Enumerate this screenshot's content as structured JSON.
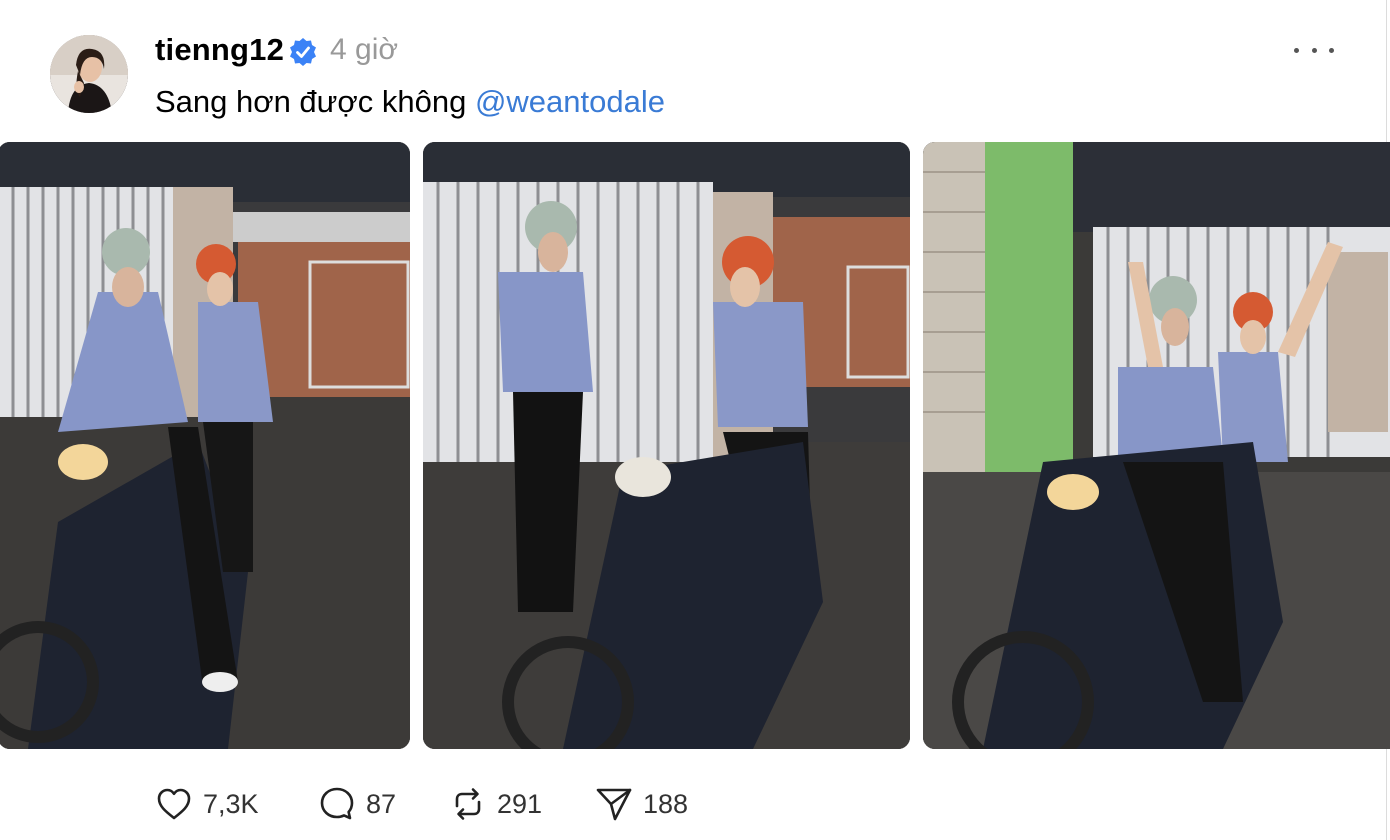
{
  "post": {
    "username": "tienng12",
    "timestamp": "4 giờ",
    "caption_text": "Sang hơn được không ",
    "mention": "@weantodale",
    "verified": true
  },
  "images": [
    {
      "name": "photo-two-riders-on-motorbike"
    },
    {
      "name": "photo-man-standing-woman-seated"
    },
    {
      "name": "photo-riders-waving"
    }
  ],
  "actions": {
    "likes": "7,3K",
    "replies": "87",
    "reposts": "291",
    "shares": "188"
  },
  "icons": {
    "like": "heart-icon",
    "reply": "comment-icon",
    "repost": "repost-icon",
    "share": "send-icon",
    "more": "more-horizontal-icon",
    "verified": "verified-badge-icon"
  },
  "colors": {
    "mention": "#3a7bd5",
    "verified": "#3b82f6",
    "timestamp": "#999999"
  }
}
